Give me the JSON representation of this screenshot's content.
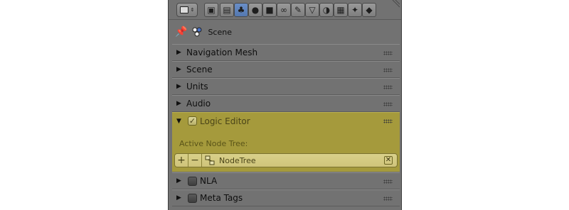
{
  "toolbar": {
    "buttons": [
      {
        "icon": "render-icon",
        "glyph": "▣",
        "active": false
      },
      {
        "icon": "render-layers-icon",
        "glyph": "▤",
        "active": false
      },
      {
        "icon": "scene-icon",
        "glyph": "♣",
        "active": true
      },
      {
        "icon": "world-icon",
        "glyph": "●",
        "active": false
      },
      {
        "icon": "object-icon",
        "glyph": "■",
        "active": false
      },
      {
        "icon": "constraints-icon",
        "glyph": "∞",
        "active": false
      },
      {
        "icon": "modifiers-icon",
        "glyph": "✎",
        "active": false
      },
      {
        "icon": "object-data-icon",
        "glyph": "▽",
        "active": false
      },
      {
        "icon": "material-icon",
        "glyph": "◑",
        "active": false
      },
      {
        "icon": "texture-icon",
        "glyph": "▦",
        "active": false
      },
      {
        "icon": "particles-icon",
        "glyph": "✦",
        "active": false
      },
      {
        "icon": "physics-icon",
        "glyph": "◆",
        "active": false
      }
    ]
  },
  "context": {
    "label": "Scene"
  },
  "panels": [
    {
      "label": "Navigation Mesh"
    },
    {
      "label": "Scene"
    },
    {
      "label": "Units"
    },
    {
      "label": "Audio"
    }
  ],
  "logic_editor": {
    "label": "Logic Editor",
    "enabled": true,
    "active_tree_label": "Active Node Tree:",
    "tree_name": "NodeTree"
  },
  "lower_panels": [
    {
      "label": "NLA",
      "enabled": false
    },
    {
      "label": "Meta Tags",
      "enabled": false
    }
  ],
  "colors": {
    "highlight": "#a59a3c",
    "panel": "#727272",
    "active_tab": "#5478b0"
  }
}
